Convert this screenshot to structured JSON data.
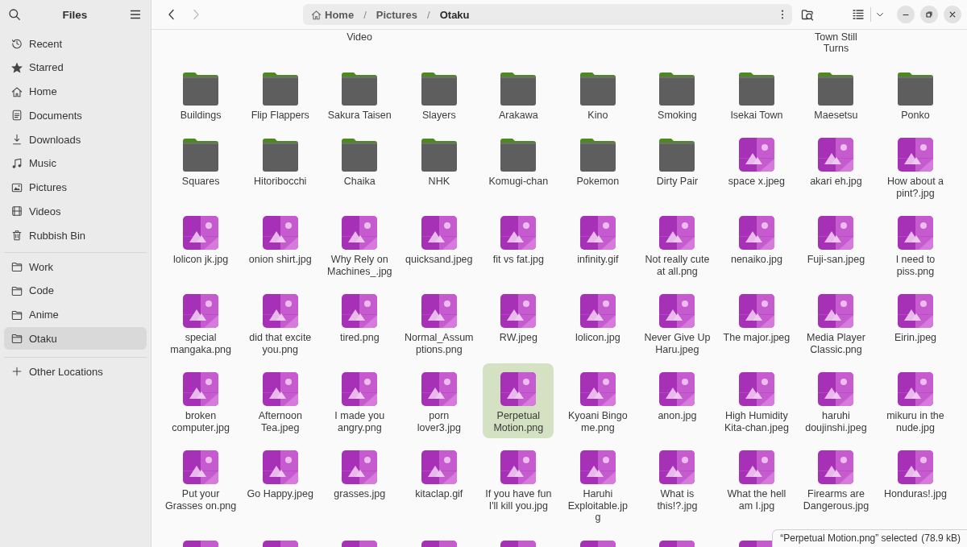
{
  "sidebar": {
    "title": "Files",
    "places": [
      {
        "label": "Recent",
        "selected": false
      },
      {
        "label": "Starred",
        "selected": false
      },
      {
        "label": "Home",
        "selected": false
      },
      {
        "label": "Documents",
        "selected": false
      },
      {
        "label": "Downloads",
        "selected": false
      },
      {
        "label": "Music",
        "selected": false
      },
      {
        "label": "Pictures",
        "selected": false
      },
      {
        "label": "Videos",
        "selected": false
      },
      {
        "label": "Rubbish Bin",
        "selected": false
      }
    ],
    "bookmarks": [
      {
        "label": "Work",
        "selected": false
      },
      {
        "label": "Code",
        "selected": false
      },
      {
        "label": "Anime",
        "selected": false
      },
      {
        "label": "Otaku",
        "selected": true
      }
    ],
    "other": {
      "label": "Other Locations",
      "selected": false
    }
  },
  "navigation": {
    "back": {
      "disabled": false
    },
    "forward": {
      "disabled": true
    }
  },
  "path": [
    {
      "kind": "segment",
      "label": "Home",
      "selected": false
    },
    {
      "kind": "separator",
      "label": "/"
    },
    {
      "kind": "segment",
      "label": "Pictures",
      "selected": false
    },
    {
      "kind": "separator",
      "label": "/"
    },
    {
      "kind": "segment",
      "label": "Otaku",
      "selected": true
    }
  ],
  "partial_row_above": [
    {
      "selected": false
    },
    {
      "selected": false
    },
    {
      "label": "Video",
      "selected": false
    },
    {
      "selected": false
    },
    {
      "selected": false
    },
    {
      "selected": false
    },
    {
      "selected": false
    },
    {
      "selected": false
    },
    {
      "label": "Town Still\nTurns",
      "selected": false
    },
    {
      "selected": false
    }
  ],
  "items": [
    {
      "kind": "folder",
      "label": "Buildings",
      "selected": false
    },
    {
      "kind": "folder",
      "label": "Flip Flappers",
      "selected": false
    },
    {
      "kind": "folder",
      "label": "Sakura Taisen",
      "selected": false
    },
    {
      "kind": "folder",
      "label": "Slayers",
      "selected": false
    },
    {
      "kind": "folder",
      "label": "Arakawa",
      "selected": false
    },
    {
      "kind": "folder",
      "label": "Kino",
      "selected": false
    },
    {
      "kind": "folder",
      "label": "Smoking",
      "selected": false
    },
    {
      "kind": "folder",
      "label": "Isekai Town",
      "selected": false
    },
    {
      "kind": "folder",
      "label": "Maesetsu",
      "selected": false
    },
    {
      "kind": "folder",
      "label": "Ponko",
      "selected": false
    },
    {
      "kind": "folder",
      "label": "Squares",
      "selected": false
    },
    {
      "kind": "folder",
      "label": "Hitoribocchi",
      "selected": false
    },
    {
      "kind": "folder",
      "label": "Chaika",
      "selected": false
    },
    {
      "kind": "folder",
      "label": "NHK",
      "selected": false
    },
    {
      "kind": "folder",
      "label": "Komugi-chan",
      "selected": false
    },
    {
      "kind": "folder",
      "label": "Pokemon",
      "selected": false
    },
    {
      "kind": "folder",
      "label": "Dirty Pair",
      "selected": false
    },
    {
      "kind": "image",
      "label": "space x.jpeg",
      "selected": false
    },
    {
      "kind": "image",
      "label": "akari eh.jpg",
      "selected": false
    },
    {
      "kind": "image",
      "label": "How about a\npint?.jpg",
      "selected": false
    },
    {
      "kind": "image",
      "label": "lolicon jk.jpg",
      "selected": false
    },
    {
      "kind": "image",
      "label": "onion shirt.jpg",
      "selected": false
    },
    {
      "kind": "image",
      "label": "Why Rely on\nMachines_.jpg",
      "selected": false
    },
    {
      "kind": "image",
      "label": "quicksand.jpeg",
      "selected": false
    },
    {
      "kind": "image",
      "label": "fit vs fat.jpg",
      "selected": false
    },
    {
      "kind": "image",
      "label": "infinity.gif",
      "selected": false
    },
    {
      "kind": "image",
      "label": "Not really cute\nat all.png",
      "selected": false
    },
    {
      "kind": "image",
      "label": "nenaiko.jpg",
      "selected": false
    },
    {
      "kind": "image",
      "label": "Fuji-san.jpeg",
      "selected": false
    },
    {
      "kind": "image",
      "label": "I need to\npiss.png",
      "selected": false
    },
    {
      "kind": "image",
      "label": "special\nmangaka.png",
      "selected": false
    },
    {
      "kind": "image",
      "label": "did that excite\nyou.png",
      "selected": false
    },
    {
      "kind": "image",
      "label": "tired.png",
      "selected": false
    },
    {
      "kind": "image",
      "label": "Normal_Assum\nptions.png",
      "selected": false
    },
    {
      "kind": "image",
      "label": "RW.jpeg",
      "selected": false
    },
    {
      "kind": "image",
      "label": "lolicon.jpg",
      "selected": false
    },
    {
      "kind": "image",
      "label": "Never Give Up\nHaru.jpeg",
      "selected": false
    },
    {
      "kind": "image",
      "label": "The major.jpeg",
      "selected": false
    },
    {
      "kind": "image",
      "label": "Media Player\nClassic.png",
      "selected": false
    },
    {
      "kind": "image",
      "label": "Eirin.jpeg",
      "selected": false
    },
    {
      "kind": "image",
      "label": "broken\ncomputer.jpg",
      "selected": false
    },
    {
      "kind": "image",
      "label": "Afternoon\nTea.jpeg",
      "selected": false
    },
    {
      "kind": "image",
      "label": "I made you\nangry.png",
      "selected": false
    },
    {
      "kind": "image",
      "label": "porn\nlover3.jpg",
      "selected": false
    },
    {
      "kind": "image",
      "label": "Perpetual\nMotion.png",
      "selected": true
    },
    {
      "kind": "image",
      "label": "Kyoani Bingo\nme.png",
      "selected": false
    },
    {
      "kind": "image",
      "label": "anon.jpg",
      "selected": false
    },
    {
      "kind": "image",
      "label": "High Humidity\nKita-chan.jpeg",
      "selected": false
    },
    {
      "kind": "image",
      "label": "haruhi\ndoujinshi.jpeg",
      "selected": false
    },
    {
      "kind": "image",
      "label": "mikuru in the\nnude.jpg",
      "selected": false
    },
    {
      "kind": "image",
      "label": "Put your\nGrasses on.png",
      "selected": false
    },
    {
      "kind": "image",
      "label": "Go Happy.jpeg",
      "selected": false
    },
    {
      "kind": "image",
      "label": "grasses.jpg",
      "selected": false
    },
    {
      "kind": "image",
      "label": "kitaclap.gif",
      "selected": false
    },
    {
      "kind": "image",
      "label": "If you have fun\nI'll kill you.jpg",
      "selected": false
    },
    {
      "kind": "image",
      "label": "Haruhi\nExploitable.jp\ng",
      "selected": false
    },
    {
      "kind": "image",
      "label": "What is\nthis!?.jpg",
      "selected": false
    },
    {
      "kind": "image",
      "label": "What the hell\nam I.jpg",
      "selected": false
    },
    {
      "kind": "image",
      "label": "Firearms are\nDangerous.jpg",
      "selected": false
    },
    {
      "kind": "image",
      "label": "Honduras!.jpg",
      "selected": false
    },
    {
      "kind": "image",
      "selected": false
    },
    {
      "kind": "image",
      "selected": false
    },
    {
      "kind": "image",
      "selected": false
    },
    {
      "kind": "image",
      "selected": false
    },
    {
      "kind": "image",
      "selected": false
    },
    {
      "kind": "image",
      "selected": false
    },
    {
      "kind": "image",
      "selected": false
    },
    {
      "kind": "image",
      "selected": false
    }
  ],
  "status": {
    "text": "“Perpetual Motion.png” selected",
    "size": "(78.9 kB)"
  }
}
